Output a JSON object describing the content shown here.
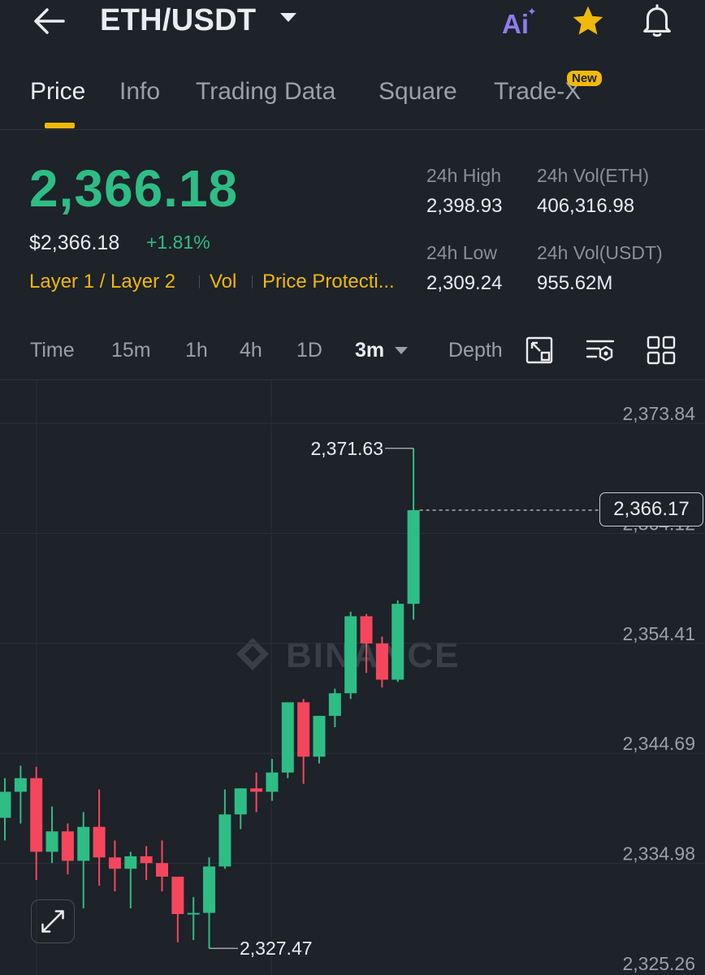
{
  "header": {
    "pair": "ETH/USDT",
    "ai_label": "Ai",
    "icons": [
      "back-arrow-icon",
      "chevron-down-icon",
      "ai-icon",
      "star-icon",
      "bell-icon"
    ],
    "favorite_color": "#f0b90b"
  },
  "tabs": [
    {
      "label": "Price",
      "active": true
    },
    {
      "label": "Info",
      "active": false
    },
    {
      "label": "Trading Data",
      "active": false
    },
    {
      "label": "Square",
      "active": false
    },
    {
      "label": "Trade-X",
      "active": false,
      "badge": "New"
    }
  ],
  "price": {
    "last": "2,366.18",
    "usd": "$2,366.18",
    "change": "+1.81%",
    "tags": [
      "Layer 1 / Layer 2",
      "Vol",
      "Price Protecti..."
    ],
    "up_color": "#2ebd85",
    "down_color": "#f6465d",
    "accent_color": "#f0b90b"
  },
  "stats": {
    "high_label": "24h High",
    "high_value": "2,398.93",
    "vol_eth_label": "24h Vol(ETH)",
    "vol_eth_value": "406,316.98",
    "low_label": "24h Low",
    "low_value": "2,309.24",
    "vol_usdt_label": "24h Vol(USDT)",
    "vol_usdt_value": "955.62M"
  },
  "intervals": [
    {
      "label": "Time",
      "active": false
    },
    {
      "label": "15m",
      "active": false
    },
    {
      "label": "1h",
      "active": false
    },
    {
      "label": "4h",
      "active": false
    },
    {
      "label": "1D",
      "active": false
    },
    {
      "label": "3m",
      "active": true
    },
    {
      "label": "Depth",
      "active": false
    }
  ],
  "toolbar_icons": [
    "chart-settings-icon",
    "indicator-settings-icon",
    "layout-grid-icon"
  ],
  "watermark": "BINANCE",
  "chart_data": {
    "type": "candlestick",
    "yticks": [
      "2,373.84",
      "2,364.12",
      "2,354.41",
      "2,344.69",
      "2,334.98",
      "2,325.26"
    ],
    "ylim": [
      2325.26,
      2373.84
    ],
    "current_price": "2,366.17",
    "max_label": "2,371.63",
    "min_label": "2,327.47",
    "candles": [
      {
        "o": 2339.0,
        "h": 2342.5,
        "l": 2337.0,
        "c": 2341.3
      },
      {
        "o": 2341.3,
        "h": 2343.6,
        "l": 2338.5,
        "c": 2342.5
      },
      {
        "o": 2342.5,
        "h": 2343.5,
        "l": 2333.5,
        "c": 2336.0
      },
      {
        "o": 2336.0,
        "h": 2340.0,
        "l": 2335.0,
        "c": 2337.8
      },
      {
        "o": 2337.8,
        "h": 2338.5,
        "l": 2334.0,
        "c": 2335.2
      },
      {
        "o": 2335.2,
        "h": 2339.5,
        "l": 2331.0,
        "c": 2338.2
      },
      {
        "o": 2338.2,
        "h": 2341.5,
        "l": 2333.0,
        "c": 2335.5
      },
      {
        "o": 2335.5,
        "h": 2337.0,
        "l": 2332.5,
        "c": 2334.5
      },
      {
        "o": 2334.5,
        "h": 2336.0,
        "l": 2331.0,
        "c": 2335.6
      },
      {
        "o": 2335.6,
        "h": 2336.5,
        "l": 2333.5,
        "c": 2335.0
      },
      {
        "o": 2335.0,
        "h": 2337.0,
        "l": 2332.5,
        "c": 2333.8
      },
      {
        "o": 2333.8,
        "h": 2333.8,
        "l": 2328.0,
        "c": 2330.5
      },
      {
        "o": 2330.5,
        "h": 2332.0,
        "l": 2328.2,
        "c": 2330.6
      },
      {
        "o": 2330.6,
        "h": 2335.5,
        "l": 2327.47,
        "c": 2334.7
      },
      {
        "o": 2334.7,
        "h": 2341.5,
        "l": 2334.5,
        "c": 2339.3
      },
      {
        "o": 2339.3,
        "h": 2341.6,
        "l": 2338.0,
        "c": 2341.6
      },
      {
        "o": 2341.6,
        "h": 2343.0,
        "l": 2339.5,
        "c": 2341.3
      },
      {
        "o": 2341.3,
        "h": 2344.2,
        "l": 2340.5,
        "c": 2343.0
      },
      {
        "o": 2343.0,
        "h": 2349.2,
        "l": 2342.5,
        "c": 2349.2
      },
      {
        "o": 2349.2,
        "h": 2349.5,
        "l": 2342.0,
        "c": 2344.4
      },
      {
        "o": 2344.4,
        "h": 2348.0,
        "l": 2343.8,
        "c": 2348.0
      },
      {
        "o": 2348.0,
        "h": 2350.4,
        "l": 2347.0,
        "c": 2350.0
      },
      {
        "o": 2350.0,
        "h": 2357.2,
        "l": 2349.5,
        "c": 2356.8
      },
      {
        "o": 2356.8,
        "h": 2357.0,
        "l": 2351.8,
        "c": 2354.4
      },
      {
        "o": 2354.4,
        "h": 2355.0,
        "l": 2350.5,
        "c": 2351.2
      },
      {
        "o": 2351.2,
        "h": 2358.2,
        "l": 2351.0,
        "c": 2357.9
      },
      {
        "o": 2357.9,
        "h": 2371.63,
        "l": 2356.5,
        "c": 2366.17
      }
    ]
  }
}
